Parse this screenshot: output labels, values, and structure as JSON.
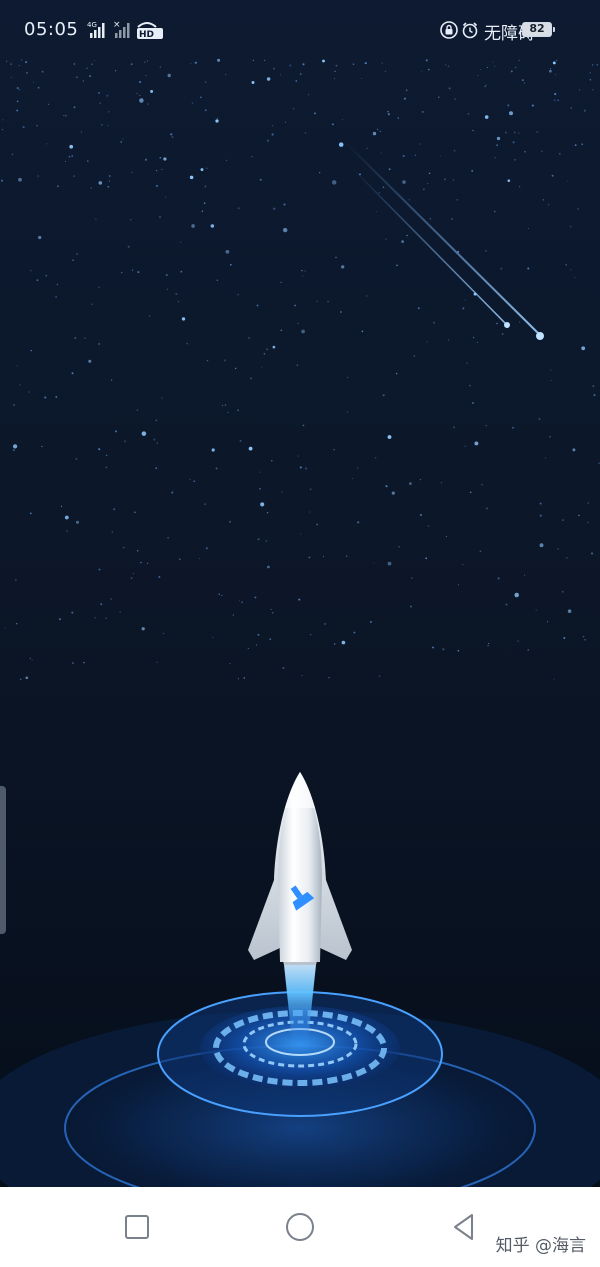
{
  "status_bar": {
    "time": "05:05",
    "network_label": "4G",
    "hd_label": "HD",
    "accessibility_label": "无障碍",
    "battery_level": "82",
    "icons": [
      "signal-4g-icon",
      "signal-no-sim-icon",
      "hd-call-icon",
      "lock-icon",
      "alarm-icon",
      "battery-icon"
    ]
  },
  "launch_screen": {
    "rocket_logo_icon": "broom-icon",
    "colors": {
      "background_top": "#0d1a31",
      "background_bottom": "#050d19",
      "accent_glow": "#2f8fff",
      "rocket_body": "#f2f5f8"
    }
  },
  "nav_bar": {
    "icons": [
      "recents-square-icon",
      "home-circle-icon",
      "back-triangle-icon"
    ]
  },
  "watermark": "知乎 @海言"
}
